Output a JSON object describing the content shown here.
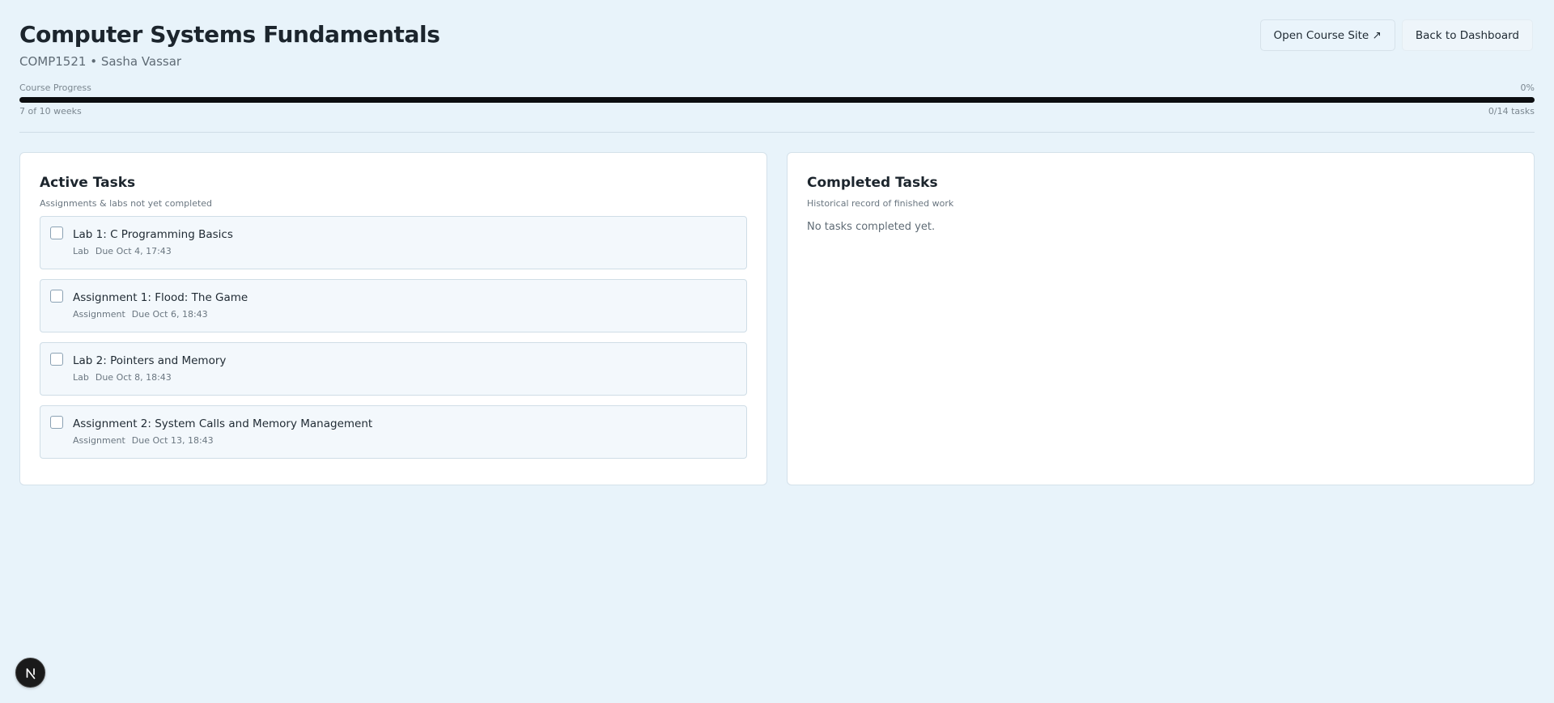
{
  "header": {
    "title": "Computer Systems Fundamentals",
    "subtitle": "COMP1521 • Sasha Vassar",
    "open_course_site_label": "Open Course Site ↗",
    "back_to_dashboard_label": "Back to Dashboard"
  },
  "progress": {
    "label": "Course Progress",
    "percent_text": "0%",
    "percent_value": 0,
    "weeks_text": "7 of 10 weeks",
    "tasks_text": "0/14 tasks"
  },
  "active_tasks": {
    "title": "Active Tasks",
    "description": "Assignments & labs not yet completed",
    "items": [
      {
        "title": "Lab 1: C Programming Basics",
        "type": "Lab",
        "due": "Due Oct 4, 17:43"
      },
      {
        "title": "Assignment 1: Flood: The Game",
        "type": "Assignment",
        "due": "Due Oct 6, 18:43"
      },
      {
        "title": "Lab 2: Pointers and Memory",
        "type": "Lab",
        "due": "Due Oct 8, 18:43"
      },
      {
        "title": "Assignment 2: System Calls and Memory Management",
        "type": "Assignment",
        "due": "Due Oct 13, 18:43"
      }
    ]
  },
  "completed_tasks": {
    "title": "Completed Tasks",
    "description": "Historical record of finished work",
    "empty_text": "No tasks completed yet."
  },
  "icons": {
    "external_link": "external-link-icon",
    "next_logo": "nextjs-logo-icon"
  },
  "colors": {
    "background": "#e8f3fa",
    "progress_track": "#0b0d10",
    "panel": "#ffffff",
    "task_item": "#f3f8fc"
  }
}
